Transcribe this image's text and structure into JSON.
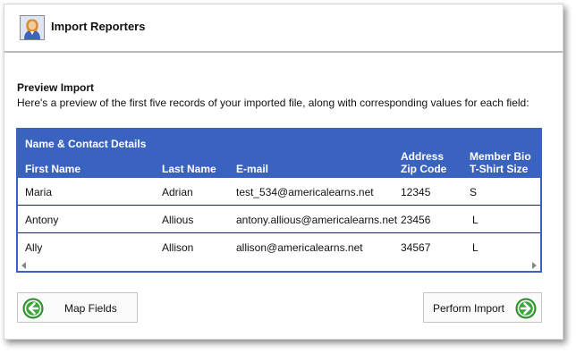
{
  "header": {
    "title": "Import Reporters",
    "avatar_icon": "user-avatar-icon"
  },
  "preview": {
    "title": "Preview Import",
    "description": "Here's a preview of the first five records of your imported file, along with corresponding values for each field:"
  },
  "grid": {
    "group_label": "Name & Contact Details",
    "columns": {
      "first_name": "First Name",
      "last_name": "Last Name",
      "email": "E-mail",
      "address_group": "Address",
      "zip": "Zip Code",
      "member_group": "Member Bio",
      "tshirt": "T-Shirt Size"
    },
    "rows": [
      {
        "first": "Maria",
        "last": "Adrian",
        "email": "test_534@americalearns.net",
        "zip": "12345",
        "size": "S"
      },
      {
        "first": "Antony",
        "last": "Allious",
        "email": "antony.allious@americalearns.net",
        "zip": "23456",
        "size": "L"
      },
      {
        "first": "Ally",
        "last": "Allison",
        "email": "allison@americalearns.net",
        "zip": "34567",
        "size": "L"
      }
    ]
  },
  "buttons": {
    "map_fields": "Map Fields",
    "perform_import": "Perform Import"
  },
  "colors": {
    "grid_header": "#3a62bf",
    "button_icon": "#3ca63a"
  }
}
